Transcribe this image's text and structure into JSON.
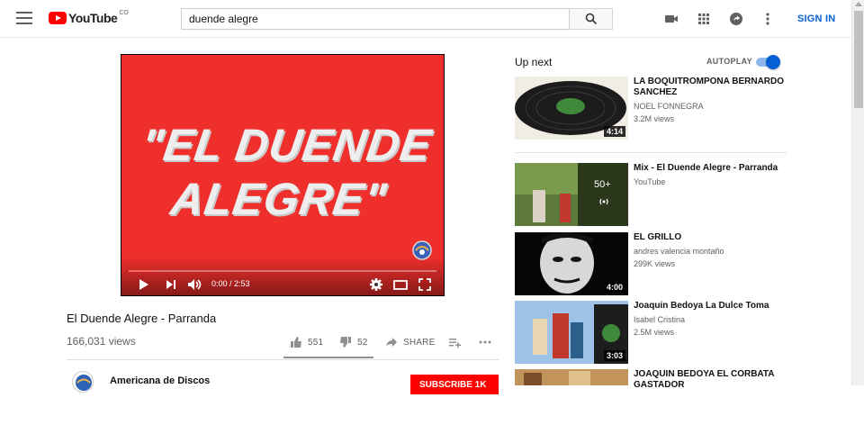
{
  "header": {
    "logo_text": "YouTube",
    "country_code": "CO",
    "search_value": "duende alegre",
    "signin_label": "SIGN IN",
    "icons": [
      "menu-icon",
      "search-icon",
      "video-camera-icon",
      "apps-icon",
      "share-icon",
      "more-vertical-icon"
    ]
  },
  "player": {
    "screen_text_line1": "\"EL DUENDE",
    "screen_text_line2": "ALEGRE\"",
    "time": "0:00 / 2:53",
    "progress_loaded": 0.09,
    "screen_color": "#ee2f2b"
  },
  "video": {
    "title": "El Duende Alegre - Parranda",
    "views": "166,031 views",
    "likes": "551",
    "dislikes": "52",
    "share_label": "SHARE",
    "like_ratio": 0.91
  },
  "channel": {
    "name": "Americana de Discos",
    "subscribe_label": "SUBSCRIBE 1K"
  },
  "sidebar": {
    "up_next_label": "Up next",
    "autoplay_label": "AUTOPLAY",
    "autoplay_on": true,
    "items": [
      {
        "title": "LA BOQUITROMPONA BERNARDO SANCHEZ",
        "channel": "NOEL FONNEGRA",
        "views": "3.2M views",
        "duration": "4:14"
      },
      {
        "title": "Mix - El Duende Alegre - Parranda",
        "channel": "YouTube",
        "views": "",
        "mix_count": "50+"
      },
      {
        "title": "EL GRILLO",
        "channel": "andres valencia montaño",
        "views": "299K views",
        "duration": "4:00"
      },
      {
        "title": "Joaquin Bedoya La Dulce Toma",
        "channel": "Isabel Cristina",
        "views": "2.5M views",
        "duration": "3:03"
      },
      {
        "title": "JOAQUIN BEDOYA EL CORBATA GASTADOR",
        "channel": "",
        "views": "",
        "duration": ""
      }
    ]
  }
}
